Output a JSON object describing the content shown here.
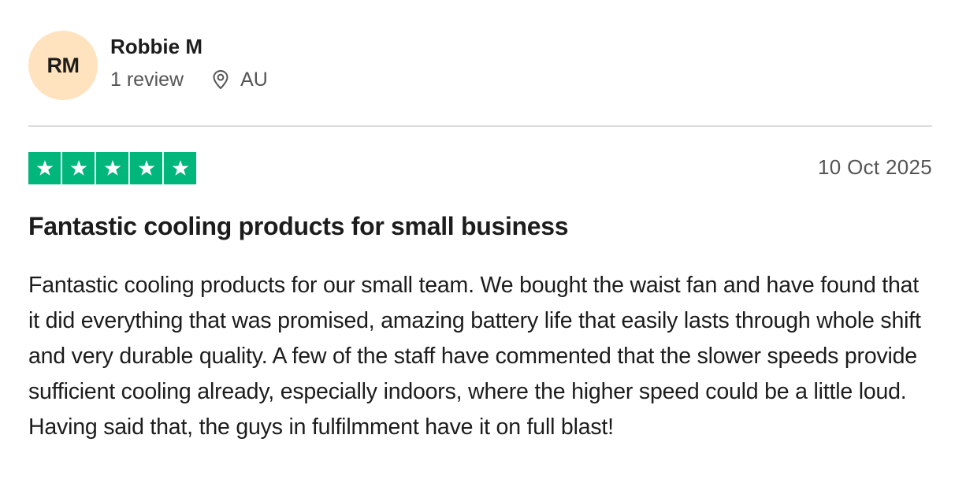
{
  "reviewer": {
    "initials": "RM",
    "name": "Robbie M",
    "review_count": "1 review",
    "location": "AU",
    "location_icon": "map-pin-icon"
  },
  "rating": {
    "stars": 5,
    "max_stars": 5,
    "star_color": "#00b67a",
    "star_icon": "star-icon"
  },
  "review": {
    "date": "10 Oct 2025",
    "title": "Fantastic cooling products for small business",
    "body": "Fantastic cooling products for our small team. We bought the waist fan and have found that it did everything that was promised, amazing battery life that easily lasts through whole shift and very durable quality. A few of the staff have commented that the slower speeds provide sufficient cooling already, especially indoors, where the higher speed could be a little loud. Having said that, the guys in fulfilmment have it on full blast!"
  },
  "colors": {
    "avatar_background": "#ffe2be",
    "divider": "#dcdcdc",
    "muted_text": "#555555"
  }
}
